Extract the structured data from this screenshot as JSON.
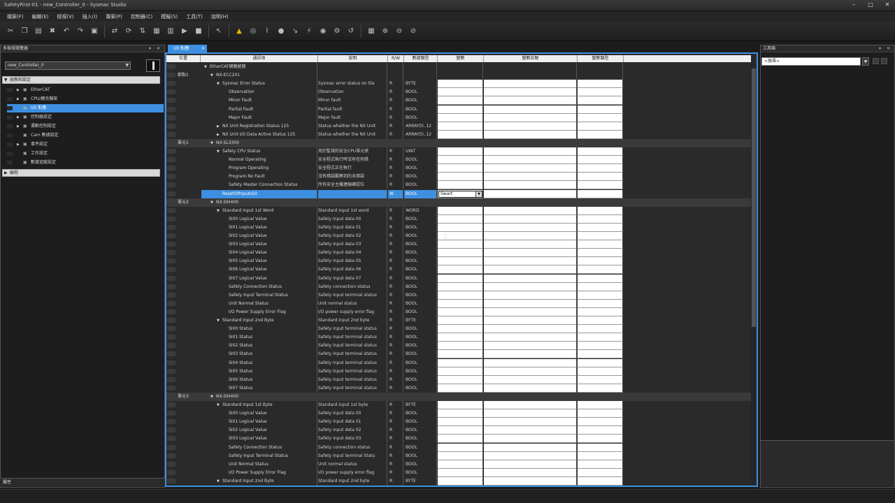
{
  "window": {
    "title": "SafetyFirst-01 - new_Controller_0 - Sysmac Studio",
    "buttons": [
      "–",
      "□",
      "✕"
    ]
  },
  "menu": [
    "檔案(F)",
    "編輯(E)",
    "檢視(V)",
    "插入(I)",
    "專案(P)",
    "控制器(C)",
    "模擬(S)",
    "工具(T)",
    "說明(H)"
  ],
  "left_panel": {
    "title": "多檢視瀏覽器",
    "controller": "new_Controller_0",
    "config_section": "組態和設定",
    "tree": [
      {
        "label": "EtherCAT",
        "exp": "▶"
      },
      {
        "label": "CPU/擴充機架",
        "exp": "▶"
      },
      {
        "label": "I/O 對應",
        "exp": ""
      },
      {
        "label": "控制器設定",
        "exp": "▶"
      },
      {
        "label": "運動控制設定",
        "exp": "▶"
      },
      {
        "label": "Cam 數據設定",
        "exp": ""
      },
      {
        "label": "事件設定",
        "exp": "▶"
      },
      {
        "label": "工作設定",
        "exp": ""
      },
      {
        "label": "數據追蹤設定",
        "exp": ""
      }
    ],
    "programming_section": "編程",
    "footer": "屬性"
  },
  "right_panel": {
    "title": "工具箱",
    "search_value": "<搜尋>"
  },
  "doc_tab": {
    "label": "I/O 對應"
  },
  "grid": {
    "headers": [
      "位置",
      "通訊埠",
      "說明",
      "R/W",
      "數據類型",
      "變數",
      "變數註解",
      "變數類型"
    ],
    "selected_var_value": "Swart",
    "rows": [
      {
        "t": "g",
        "pos": "",
        "lvl": 0,
        "arr": "▼",
        "name": "EtherCAT網路組態",
        "desc": "",
        "rw": "",
        "dt": ""
      },
      {
        "t": "g",
        "pos": "節點1",
        "lvl": 1,
        "arr": "▼",
        "name": "NX-ECC201",
        "desc": "",
        "rw": "",
        "dt": ""
      },
      {
        "t": "io",
        "pos": "",
        "lvl": 2,
        "arr": "▼",
        "name": "Sysmac Error Status",
        "desc": "Sysmac error status on Sla",
        "rw": "R",
        "dt": "BYTE"
      },
      {
        "t": "io",
        "pos": "",
        "lvl": 3,
        "arr": "",
        "name": "Observation",
        "desc": "Observation",
        "rw": "R",
        "dt": "BOOL"
      },
      {
        "t": "io",
        "pos": "",
        "lvl": 3,
        "arr": "",
        "name": "Minor Fault",
        "desc": "Minor fault",
        "rw": "R",
        "dt": "BOOL"
      },
      {
        "t": "io",
        "pos": "",
        "lvl": 3,
        "arr": "",
        "name": "Partial Fault",
        "desc": "Partial fault",
        "rw": "R",
        "dt": "BOOL"
      },
      {
        "t": "io",
        "pos": "",
        "lvl": 3,
        "arr": "",
        "name": "Major Fault",
        "desc": "Major fault",
        "rw": "R",
        "dt": "BOOL"
      },
      {
        "t": "io",
        "pos": "",
        "lvl": 2,
        "arr": "▶",
        "name": "NX Unit Registration Status 125",
        "desc": "Status whether the NX Unit",
        "rw": "R",
        "dt": "ARRAY[0..12"
      },
      {
        "t": "io",
        "pos": "",
        "lvl": 2,
        "arr": "▶",
        "name": "NX Unit I/O Data Active Status 125",
        "desc": "Status whether the NX Unit",
        "rw": "R",
        "dt": "ARRAY[0..12"
      },
      {
        "t": "unit",
        "pos": "單元1",
        "lvl": 1,
        "arr": "▼",
        "name": "NX-SL3300",
        "desc": "",
        "rw": "",
        "dt": ""
      },
      {
        "t": "io",
        "pos": "",
        "lvl": 2,
        "arr": "▼",
        "name": "Safety CPU Status",
        "desc": "用於監視的安全CPU單元狀",
        "rw": "R",
        "dt": "UINT"
      },
      {
        "t": "io",
        "pos": "",
        "lvl": 3,
        "arr": "",
        "name": "Normal Operating",
        "desc": "安全程式執行時沒有任何錯",
        "rw": "R",
        "dt": "BOOL"
      },
      {
        "t": "io",
        "pos": "",
        "lvl": 3,
        "arr": "",
        "name": "Program Operating",
        "desc": "安全程式正在執行",
        "rw": "R",
        "dt": "BOOL"
      },
      {
        "t": "io",
        "pos": "",
        "lvl": 3,
        "arr": "",
        "name": "Program No Fault",
        "desc": "沒有錯誤觀察到的未錯誤",
        "rw": "R",
        "dt": "BOOL"
      },
      {
        "t": "io",
        "pos": "",
        "lvl": 3,
        "arr": "",
        "name": "Safety Master Connection Status",
        "desc": "所有安全主機連線確認位",
        "rw": "R",
        "dt": "BOOL"
      },
      {
        "t": "sel",
        "pos": "",
        "lvl": 2,
        "arr": "",
        "name": "ResetOfInputs50",
        "desc": "",
        "rw": "W",
        "dt": "BOOL"
      },
      {
        "t": "unit",
        "pos": "單元2",
        "lvl": 1,
        "arr": "▼",
        "name": "NX-SIH400",
        "desc": "",
        "rw": "",
        "dt": ""
      },
      {
        "t": "io",
        "pos": "",
        "lvl": 2,
        "arr": "▼",
        "name": "Standard Input 1st Word",
        "desc": "Standard input 1st word",
        "rw": "R",
        "dt": "WORD"
      },
      {
        "t": "io",
        "pos": "",
        "lvl": 3,
        "arr": "",
        "name": "SI00 Logical Value",
        "desc": "Safety input data 00",
        "rw": "R",
        "dt": "BOOL"
      },
      {
        "t": "io",
        "pos": "",
        "lvl": 3,
        "arr": "",
        "name": "SI01 Logical Value",
        "desc": "Safety input data 01",
        "rw": "R",
        "dt": "BOOL"
      },
      {
        "t": "io",
        "pos": "",
        "lvl": 3,
        "arr": "",
        "name": "SI02 Logical Value",
        "desc": "Safety input data 02",
        "rw": "R",
        "dt": "BOOL"
      },
      {
        "t": "io",
        "pos": "",
        "lvl": 3,
        "arr": "",
        "name": "SI03 Logical Value",
        "desc": "Safety input data 03",
        "rw": "R",
        "dt": "BOOL"
      },
      {
        "t": "io",
        "pos": "",
        "lvl": 3,
        "arr": "",
        "name": "SI04 Logical Value",
        "desc": "Safety input data 04",
        "rw": "R",
        "dt": "BOOL"
      },
      {
        "t": "io",
        "pos": "",
        "lvl": 3,
        "arr": "",
        "name": "SI05 Logical Value",
        "desc": "Safety input data 05",
        "rw": "R",
        "dt": "BOOL"
      },
      {
        "t": "io",
        "pos": "",
        "lvl": 3,
        "arr": "",
        "name": "SI06 Logical Value",
        "desc": "Safety input data 06",
        "rw": "R",
        "dt": "BOOL"
      },
      {
        "t": "io",
        "pos": "",
        "lvl": 3,
        "arr": "",
        "name": "SI07 Logical Value",
        "desc": "Safety input data 07",
        "rw": "R",
        "dt": "BOOL"
      },
      {
        "t": "io",
        "pos": "",
        "lvl": 3,
        "arr": "",
        "name": "Safety Connection Status",
        "desc": "Safety connection status",
        "rw": "R",
        "dt": "BOOL"
      },
      {
        "t": "io",
        "pos": "",
        "lvl": 3,
        "arr": "",
        "name": "Safety Input Terminal Status",
        "desc": "Safety input terminal status",
        "rw": "R",
        "dt": "BOOL"
      },
      {
        "t": "io",
        "pos": "",
        "lvl": 3,
        "arr": "",
        "name": "Unit Normal Status",
        "desc": "Unit normal status",
        "rw": "R",
        "dt": "BOOL"
      },
      {
        "t": "io",
        "pos": "",
        "lvl": 3,
        "arr": "",
        "name": "I/O Power Supply Error Flag",
        "desc": "I/O power supply error flag",
        "rw": "R",
        "dt": "BOOL"
      },
      {
        "t": "io",
        "pos": "",
        "lvl": 2,
        "arr": "▼",
        "name": "Standard Input 2nd Byte",
        "desc": "Standard input 2nd byte",
        "rw": "R",
        "dt": "BYTE"
      },
      {
        "t": "io",
        "pos": "",
        "lvl": 3,
        "arr": "",
        "name": "SI00 Status",
        "desc": "Safety input terminal status",
        "rw": "R",
        "dt": "BOOL"
      },
      {
        "t": "io",
        "pos": "",
        "lvl": 3,
        "arr": "",
        "name": "SI01 Status",
        "desc": "Safety input terminal status",
        "rw": "R",
        "dt": "BOOL"
      },
      {
        "t": "io",
        "pos": "",
        "lvl": 3,
        "arr": "",
        "name": "SI02 Status",
        "desc": "Safety input terminal status",
        "rw": "R",
        "dt": "BOOL"
      },
      {
        "t": "io",
        "pos": "",
        "lvl": 3,
        "arr": "",
        "name": "SI03 Status",
        "desc": "Safety input terminal status",
        "rw": "R",
        "dt": "BOOL"
      },
      {
        "t": "io",
        "pos": "",
        "lvl": 3,
        "arr": "",
        "name": "SI04 Status",
        "desc": "Safety input terminal status",
        "rw": "R",
        "dt": "BOOL"
      },
      {
        "t": "io",
        "pos": "",
        "lvl": 3,
        "arr": "",
        "name": "SI05 Status",
        "desc": "Safety input terminal status",
        "rw": "R",
        "dt": "BOOL"
      },
      {
        "t": "io",
        "pos": "",
        "lvl": 3,
        "arr": "",
        "name": "SI06 Status",
        "desc": "Safety input terminal status",
        "rw": "R",
        "dt": "BOOL"
      },
      {
        "t": "io",
        "pos": "",
        "lvl": 3,
        "arr": "",
        "name": "SI07 Status",
        "desc": "Safety input terminal status",
        "rw": "R",
        "dt": "BOOL"
      },
      {
        "t": "unit",
        "pos": "單元3",
        "lvl": 1,
        "arr": "▼",
        "name": "NX-SIH400",
        "desc": "",
        "rw": "",
        "dt": ""
      },
      {
        "t": "io",
        "pos": "",
        "lvl": 2,
        "arr": "▼",
        "name": "Standard Input 1st Byte",
        "desc": "Standard input 1st byte",
        "rw": "R",
        "dt": "BYTE"
      },
      {
        "t": "io",
        "pos": "",
        "lvl": 3,
        "arr": "",
        "name": "SI00 Logical Value",
        "desc": "Safety input data 00",
        "rw": "R",
        "dt": "BOOL"
      },
      {
        "t": "io",
        "pos": "",
        "lvl": 3,
        "arr": "",
        "name": "SI01 Logical Value",
        "desc": "Safety input data 01",
        "rw": "R",
        "dt": "BOOL"
      },
      {
        "t": "io",
        "pos": "",
        "lvl": 3,
        "arr": "",
        "name": "SI02 Logical Value",
        "desc": "Safety input data 02",
        "rw": "R",
        "dt": "BOOL"
      },
      {
        "t": "io",
        "pos": "",
        "lvl": 3,
        "arr": "",
        "name": "SI03 Logical Value",
        "desc": "Safety input data 03",
        "rw": "R",
        "dt": "BOOL"
      },
      {
        "t": "io",
        "pos": "",
        "lvl": 3,
        "arr": "",
        "name": "Safety Connection Status",
        "desc": "Safety connection status",
        "rw": "R",
        "dt": "BOOL"
      },
      {
        "t": "io",
        "pos": "",
        "lvl": 3,
        "arr": "",
        "name": "Safety Input Terminal Status",
        "desc": "Safety input terminal Statu",
        "rw": "R",
        "dt": "BOOL"
      },
      {
        "t": "io",
        "pos": "",
        "lvl": 3,
        "arr": "",
        "name": "Unit Normal Status",
        "desc": "Unit normal status",
        "rw": "R",
        "dt": "BOOL"
      },
      {
        "t": "io",
        "pos": "",
        "lvl": 3,
        "arr": "",
        "name": "I/O Power Supply Error Flag",
        "desc": "I/O power supply error flag",
        "rw": "R",
        "dt": "BOOL"
      },
      {
        "t": "io",
        "pos": "",
        "lvl": 2,
        "arr": "▼",
        "name": "Standard Input 2nd Byte",
        "desc": "Standard input 2nd byte",
        "rw": "R",
        "dt": "BYTE"
      }
    ]
  }
}
